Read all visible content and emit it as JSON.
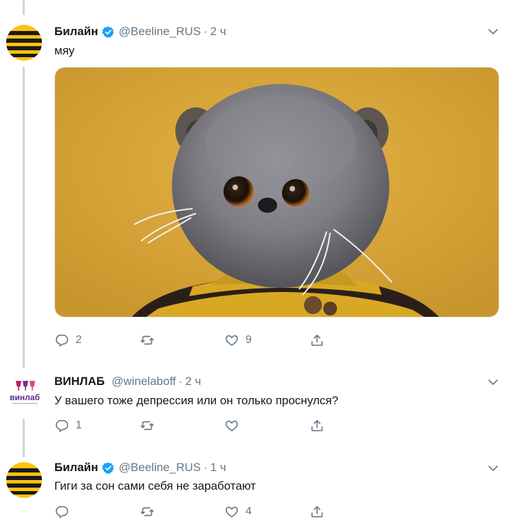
{
  "tweets": [
    {
      "name": "Билайн",
      "handle": "@Beeline_RUS",
      "separator": "·",
      "time": "2 ч",
      "text": "мяу",
      "verified": true,
      "avatar_icon": "beeline-logo",
      "replies": "2",
      "retweets": "",
      "likes": "9",
      "media": {
        "description_icon": "plush-cat-photo"
      }
    },
    {
      "name": "ВИНЛАБ",
      "handle": "@winelaboff",
      "separator": "·",
      "time": "2 ч",
      "text": "У вашего тоже депрессия или он только проснулся?",
      "verified": false,
      "avatar_icon": "winlab-logo",
      "avatar_text": "винлаб",
      "replies": "1",
      "retweets": "",
      "likes": ""
    },
    {
      "name": "Билайн",
      "handle": "@Beeline_RUS",
      "separator": "·",
      "time": "1 ч",
      "text": "Гиги за сон сами себя не заработают",
      "verified": true,
      "avatar_icon": "beeline-logo",
      "replies": "",
      "retweets": "",
      "likes": "4"
    }
  ],
  "colors": {
    "accent": "#1da1f2",
    "muted": "#657786",
    "beeline_yellow": "#ffc20e",
    "beeline_black": "#1a1a1a"
  }
}
